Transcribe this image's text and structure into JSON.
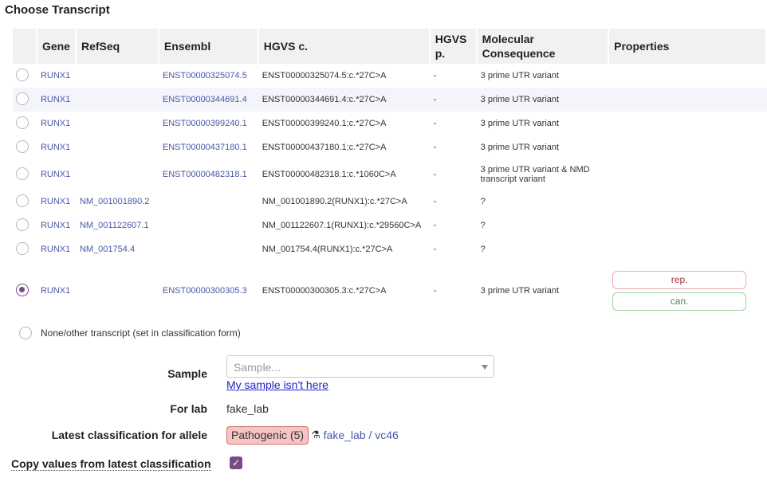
{
  "title": "Choose Transcript",
  "table": {
    "headers": {
      "gene": "Gene",
      "refseq": "RefSeq",
      "ensembl": "Ensembl",
      "hgvs_c": "HGVS c.",
      "hgvs_p": "HGVS p.",
      "molecular_consequence": "Molecular Consequence",
      "properties": "Properties"
    },
    "rows": [
      {
        "gene": "RUNX1",
        "refseq": "",
        "ensembl": "ENST00000325074.5",
        "hgvs_c": "ENST00000325074.5:c.*27C>A",
        "hgvs_p": "-",
        "consequence": "3 prime UTR variant",
        "checked": false
      },
      {
        "gene": "RUNX1",
        "refseq": "",
        "ensembl": "ENST00000344691.4",
        "hgvs_c": "ENST00000344691.4:c.*27C>A",
        "hgvs_p": "-",
        "consequence": "3 prime UTR variant",
        "checked": false
      },
      {
        "gene": "RUNX1",
        "refseq": "",
        "ensembl": "ENST00000399240.1",
        "hgvs_c": "ENST00000399240.1:c.*27C>A",
        "hgvs_p": "-",
        "consequence": "3 prime UTR variant",
        "checked": false
      },
      {
        "gene": "RUNX1",
        "refseq": "",
        "ensembl": "ENST00000437180.1",
        "hgvs_c": "ENST00000437180.1:c.*27C>A",
        "hgvs_p": "-",
        "consequence": "3 prime UTR variant",
        "checked": false
      },
      {
        "gene": "RUNX1",
        "refseq": "",
        "ensembl": "ENST00000482318.1",
        "hgvs_c": "ENST00000482318.1:c.*1060C>A",
        "hgvs_p": "-",
        "consequence": "3 prime UTR variant & NMD transcript variant",
        "checked": false
      },
      {
        "gene": "RUNX1",
        "refseq": "NM_001001890.2",
        "ensembl": "",
        "hgvs_c": "NM_001001890.2(RUNX1):c.*27C>A",
        "hgvs_p": "-",
        "consequence": "?",
        "checked": false
      },
      {
        "gene": "RUNX1",
        "refseq": "NM_001122607.1",
        "ensembl": "",
        "hgvs_c": "NM_001122607.1(RUNX1):c.*29560C>A",
        "hgvs_p": "-",
        "consequence": "?",
        "checked": false
      },
      {
        "gene": "RUNX1",
        "refseq": "NM_001754.4",
        "ensembl": "",
        "hgvs_c": "NM_001754.4(RUNX1):c.*27C>A",
        "hgvs_p": "-",
        "consequence": "?",
        "checked": false
      },
      {
        "gene": "RUNX1",
        "refseq": "",
        "ensembl": "ENST00000300305.3",
        "hgvs_c": "ENST00000300305.3:c.*27C>A",
        "hgvs_p": "-",
        "consequence": "3 prime UTR variant",
        "checked": true,
        "properties": [
          "rep.",
          "can."
        ]
      }
    ]
  },
  "none_option": "None/other transcript (set in classification form)",
  "form": {
    "sample_label": "Sample",
    "sample_placeholder": "Sample...",
    "sample_missing_link": "My sample isn't here",
    "for_lab_label": "For lab",
    "for_lab_value": "fake_lab",
    "latest_label": "Latest classification for allele",
    "latest_badge": "Pathogenic (5)",
    "latest_link": "fake_lab / vc46",
    "latest_icon": "lab-flask-icon",
    "copy_label": "Copy values from latest classification",
    "copy_checked": true
  },
  "colors": {
    "accent": "#7a4a86",
    "link": "#4b57a6",
    "pathogenic_bg": "#f6c4c2",
    "rep_border": "#f1a8b0",
    "can_border": "#9dd1a2"
  }
}
